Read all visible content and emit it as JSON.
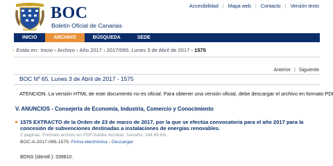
{
  "header": {
    "title": "BOC",
    "subtitle": "Boletín Oficial de Canarias",
    "top_links": [
      "Accesibilidad",
      "Mapa web",
      "Contacto",
      "Versión texto"
    ]
  },
  "nav": {
    "items": [
      "INICIO",
      "ARCHIVO",
      "BÚSQUEDA",
      "SEDE"
    ],
    "active": "ARCHIVO"
  },
  "breadcrumb": {
    "lead": "Estás en:",
    "items": [
      "Inicio",
      "Archivo",
      "Año 2017",
      "2017/065. Lunes 3 de Abril de 2017"
    ],
    "current": "1575"
  },
  "pager": {
    "prev": "Anterior",
    "next": "Siguiente"
  },
  "issue": {
    "title": "BOC Nº 65. Lunes 3 de Abril de 2017 - 1575"
  },
  "notice": "ATENCION. La versión HTML de este documento no es oficial. Para obtener una versión oficial, debe descargar el archivo en formato PDF.",
  "section": "V. ANUNCIOS - Consejería de Economía, Industria, Comercio y Conocimiento",
  "document": {
    "title": "1575 EXTRACTO de la Orden de 23 de marzo de 2017, por la que se efectúa convocatoria para el año 2017 para la concesión de subvenciones destinadas a instalaciones de energías renovables.",
    "meta": "2 páginas. Formato archivo en PDF/Adobe Acrobat. Tamaño: 244.69 Kb.",
    "code": "BOC-A-2017-065-1575.",
    "signature_link": "Firma electrónica",
    "download_link": "Descargar"
  },
  "bdns": "BDNS (Identif.): 339810.",
  "colors": {
    "navy": "#0b2d6a",
    "accent": "#e8913a",
    "link": "#1e56a0"
  }
}
